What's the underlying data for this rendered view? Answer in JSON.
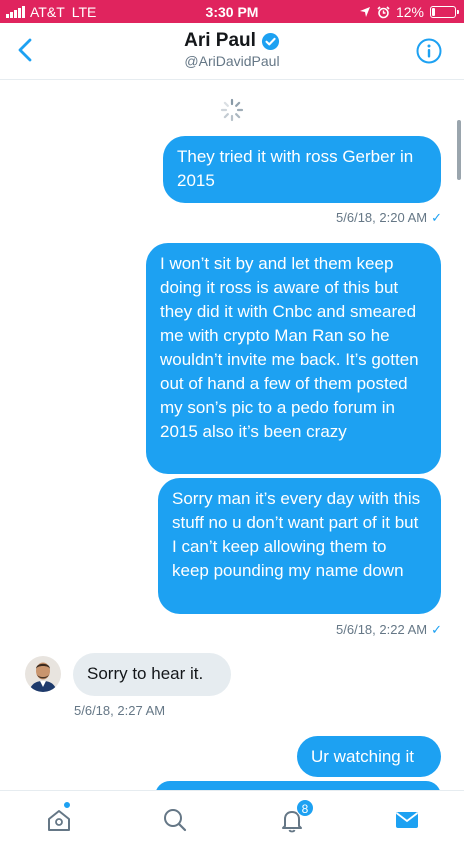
{
  "status_bar": {
    "carrier": "AT&T",
    "network": "LTE",
    "time": "3:30 PM",
    "battery": "12%",
    "battery_level": 0.12
  },
  "header": {
    "name": "Ari Paul",
    "handle": "@AriDavidPaul",
    "verified": true
  },
  "colors": {
    "accent": "#1da1f2",
    "status_bar": "#e0245e",
    "received_bubble": "#e6ecf0"
  },
  "messages": [
    {
      "text": "They tried it with ross Gerber in 2015"
    },
    {
      "time": "5/6/18, 2:20 AM"
    },
    {
      "text": "I won’t sit by and let them keep doing it ross is aware of this but they did it with Cnbc and smeared me with crypto Man Ran so he wouldn’t invite me back.  It’s gotten out of hand a few of them posted my son’s pic to a pedo forum in 2015 also it’s been crazy"
    },
    {
      "text": "Sorry man it’s every day with this stuff no u don’t want part of it but I can’t keep allowing them to keep pounding my name down"
    },
    {
      "time": "5/6/18, 2:22 AM"
    },
    {
      "text": "Sorry to hear it."
    },
    {
      "time": "5/6/18, 2:27 AM"
    },
    {
      "text": "Ur watching it"
    }
  ],
  "read_tick": "✓",
  "tabs": {
    "items": [
      "home-icon",
      "search-icon",
      "notifications-icon",
      "messages-icon"
    ],
    "notifications_badge": "8"
  }
}
